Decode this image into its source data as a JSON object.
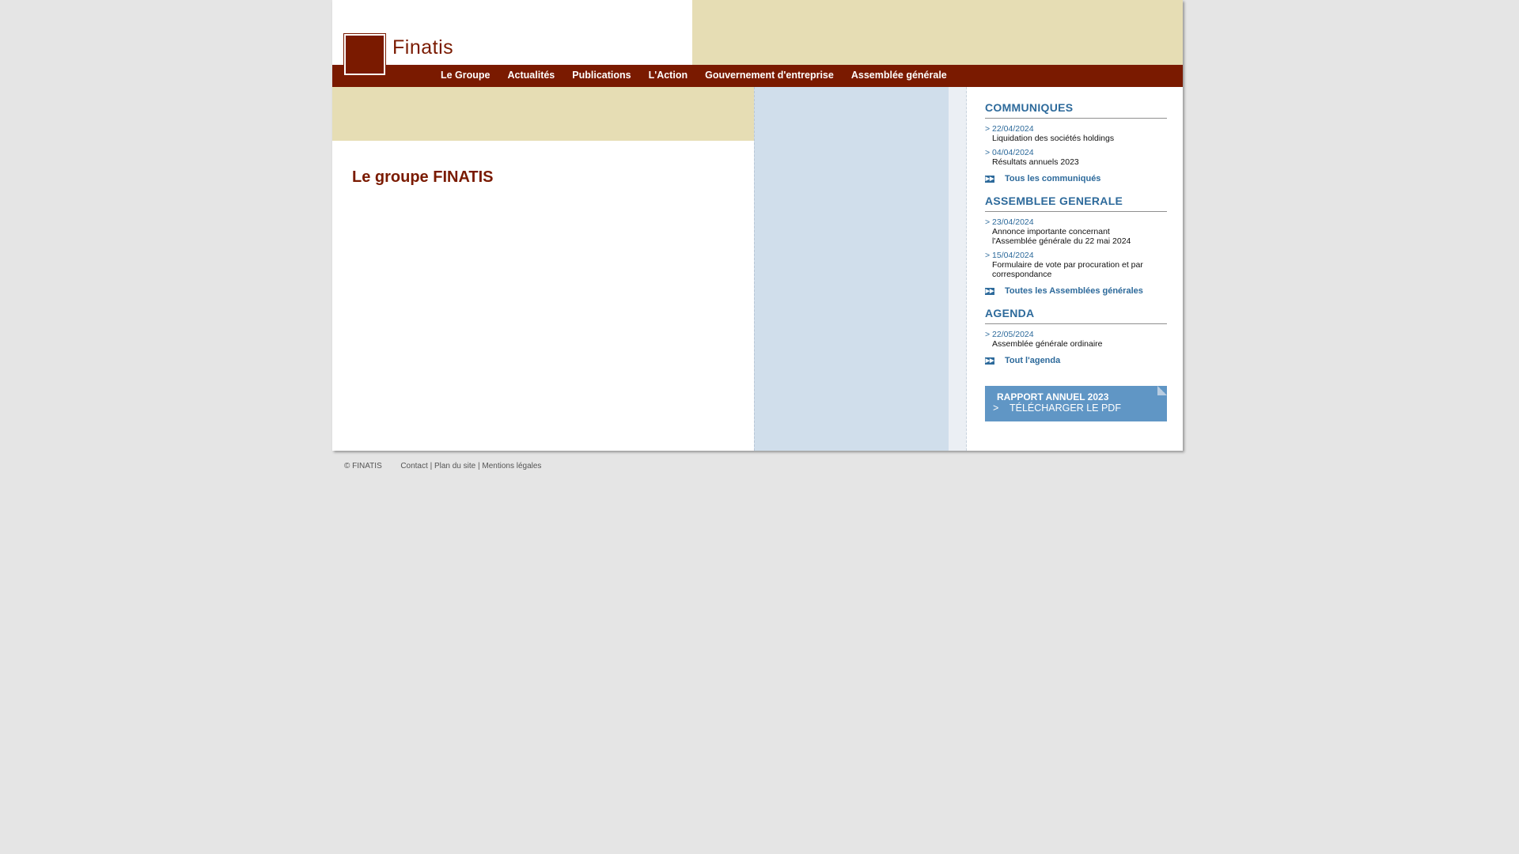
{
  "logo": {
    "name": "Finatis"
  },
  "nav": [
    "Le Groupe",
    "Actualités",
    "Publications",
    "L'Action",
    "Gouvernement d'entreprise",
    "Assemblée générale"
  ],
  "main": {
    "title": "Le groupe FINATIS"
  },
  "sidebar": {
    "communiques": {
      "heading": "COMMUNIQUES",
      "items": [
        {
          "date": "> 22/04/2024",
          "text": "Liquidation des sociétés holdings"
        },
        {
          "date": "> 04/04/2024",
          "text": "Résultats annuels 2023"
        }
      ],
      "link": "Tous les communiqués"
    },
    "assemblee": {
      "heading": "ASSEMBLEE GENERALE",
      "items": [
        {
          "date": "> 23/04/2024",
          "text1": "Annonce importante concernant",
          "text2": "l'Assemblée générale du 22 mai 2024"
        },
        {
          "date": "> 15/04/2024",
          "text1": "Formulaire de vote par procuration et par",
          "text2": "correspondance"
        }
      ],
      "link": "Toutes les Assemblées générales"
    },
    "agenda": {
      "heading": "AGENDA",
      "items": [
        {
          "date": "> 22/05/2024",
          "text": "Assemblée générale ordinaire"
        }
      ],
      "link": "Tout l'agenda"
    },
    "rapport": {
      "title": "RAPPORT ANNUEL 2023",
      "download": ">    TÉLÉCHARGER LE PDF"
    }
  },
  "footer": {
    "copyright": "© FINATIS",
    "contact": "Contact",
    "plan": "Plan du site",
    "mentions": "Mentions légales",
    "sep": "|"
  },
  "colors": {
    "brand": "#7a1a00",
    "beige": "#e6ddb4",
    "blue_text": "#2d6a9b",
    "blue_panel": "#d0deeb",
    "button": "#6096c5"
  }
}
